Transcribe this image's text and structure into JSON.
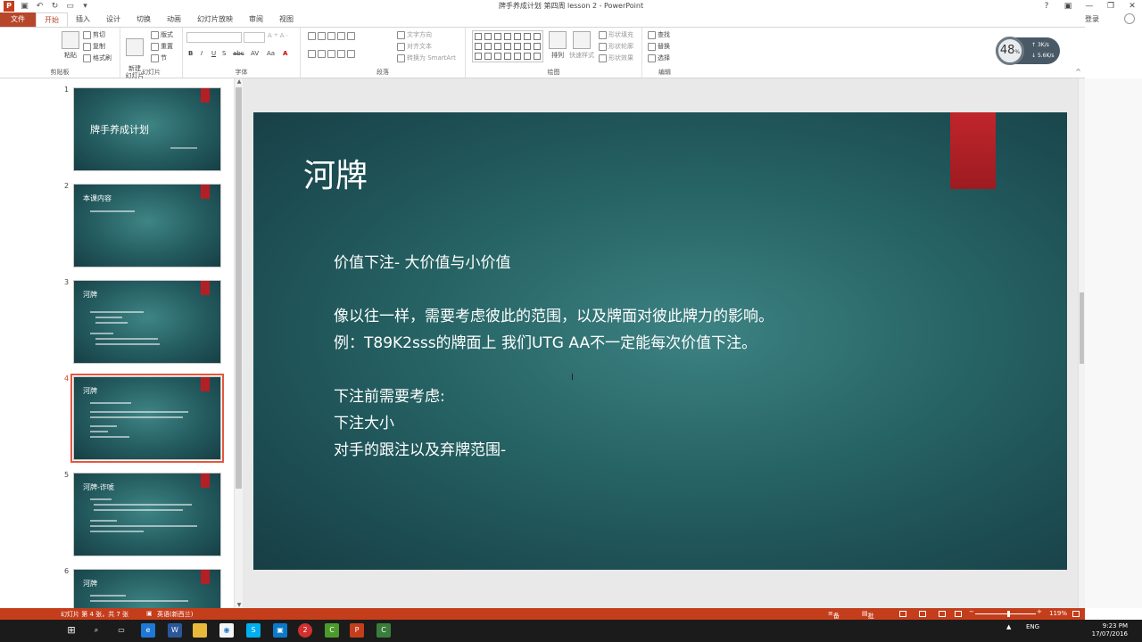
{
  "window": {
    "title": "牌手养成计划 第四周 lesson 2 - PowerPoint",
    "help": "?",
    "minimize": "—",
    "restore": "❐",
    "close": "✕"
  },
  "tabs": [
    {
      "label": "文件"
    },
    {
      "label": "开始"
    },
    {
      "label": "插入"
    },
    {
      "label": "设计"
    },
    {
      "label": "切换"
    },
    {
      "label": "动画"
    },
    {
      "label": "幻灯片放映"
    },
    {
      "label": "审阅"
    },
    {
      "label": "视图"
    }
  ],
  "account": {
    "login": "登录"
  },
  "ribbon": {
    "clipboard": {
      "paste": "粘贴",
      "cut": "剪切",
      "copy": "复制",
      "format_painter": "格式刷",
      "label": "剪贴板"
    },
    "slides": {
      "new_slide": "新建\n幻灯片",
      "layout": "版式",
      "reset": "重置",
      "section": "节",
      "label": "幻灯片"
    },
    "font": {
      "bold": "B",
      "italic": "I",
      "underline": "U",
      "strike": "S",
      "shadow": "abc",
      "spacing": "AV",
      "case": "Aa",
      "label": "字体"
    },
    "paragraph": {
      "text_direction": "文字方向",
      "align_text": "对齐文本",
      "smartart": "转换为 SmartArt",
      "label": "段落"
    },
    "drawing": {
      "arrange": "排列",
      "quick_styles": "快速样式",
      "shape_fill": "形状填充",
      "shape_outline": "形状轮廓",
      "shape_effects": "形状效果",
      "label": "绘图"
    },
    "editing": {
      "find": "查找",
      "replace": "替换",
      "select": "选择",
      "label": "编辑"
    }
  },
  "perf_overlay": {
    "percent": "48",
    "unit": "%",
    "up": "3K/s",
    "down": "5.6K/s"
  },
  "thumbnails": [
    {
      "number": "1",
      "title": "牌手养成计划"
    },
    {
      "number": "2",
      "title": "本课内容"
    },
    {
      "number": "3",
      "title": "河牌"
    },
    {
      "number": "4",
      "title": "河牌"
    },
    {
      "number": "5",
      "title": "河牌-诈唬"
    },
    {
      "number": "6",
      "title": "河牌"
    }
  ],
  "slide": {
    "title": "河牌",
    "lines": [
      "价值下注-   大价值与小价值",
      "",
      "像以往一样，需要考虑彼此的范围，以及牌面对彼此牌力的影响。",
      "例：T89K2sss的牌面上  我们UTG AA不一定能每次价值下注。",
      "",
      "下注前需要考虑:",
      "下注大小",
      "对手的跟注以及弃牌范围-"
    ]
  },
  "statusbar": {
    "slide_info": "幻灯片 第 4 张，共 7 张",
    "language": "英语(新西兰)",
    "notes": "备注",
    "comments": "批注",
    "zoom_out": "−",
    "zoom_in": "+",
    "zoom": "119%",
    "zoom_level": 0.55
  },
  "taskbar": {
    "lang": "ENG",
    "time": "9:23 PM",
    "date": "17/07/2016"
  },
  "colors": {
    "accent": "#c43e1c",
    "slide_dark": "#1d4f54",
    "slide_light": "#3d8283",
    "red_bar": "#b41f25"
  }
}
